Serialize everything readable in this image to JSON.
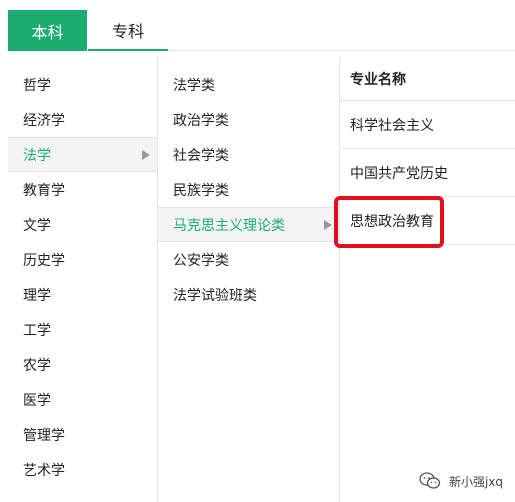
{
  "tabs": [
    {
      "label": "本科",
      "active": true
    },
    {
      "label": "专科",
      "active": false
    }
  ],
  "disciplines": [
    "哲学",
    "经济学",
    "法学",
    "教育学",
    "文学",
    "历史学",
    "理学",
    "工学",
    "农学",
    "医学",
    "管理学",
    "艺术学"
  ],
  "active_discipline": "法学",
  "categories": [
    "法学类",
    "政治学类",
    "社会学类",
    "民族学类",
    "马克思主义理论类",
    "公安学类",
    "法学试验班类"
  ],
  "active_category": "马克思主义理论类",
  "majors": {
    "header": "专业名称",
    "items": [
      "科学社会主义",
      "中国共产党历史",
      "思想政治教育"
    ],
    "highlighted": "思想政治教育"
  },
  "colors": {
    "accent": "#1aad6e",
    "highlight": "#e0101f"
  },
  "watermark": {
    "text": "新小强jxq",
    "icon": "wechat-icon"
  }
}
